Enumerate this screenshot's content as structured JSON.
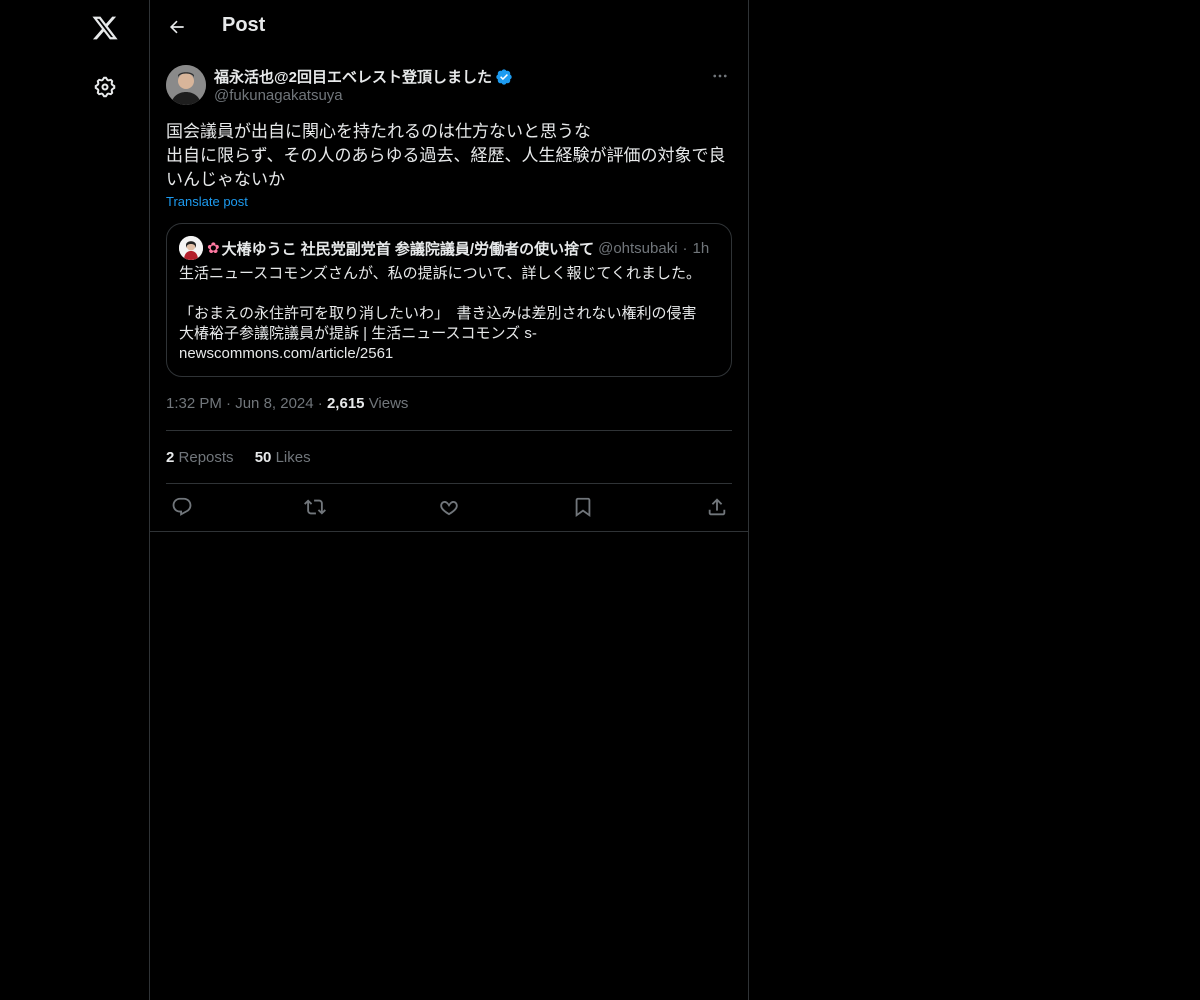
{
  "header": {
    "title": "Post"
  },
  "post": {
    "author_name": "福永活也@2回目エベレスト登頂しました",
    "author_handle": "@fukunagakatsuya",
    "text": "国会議員が出自に関心を持たれるのは仕方ないと思うな\n出自に限らず、その人のあらゆる過去、経歴、人生経験が評価の対象で良いんじゃないか",
    "translate_label": "Translate post",
    "time": "1:32 PM",
    "date": "Jun 8, 2024",
    "views_count": "2,615",
    "views_label": "Views",
    "reposts_count": "2",
    "reposts_label": "Reposts",
    "likes_count": "50",
    "likes_label": "Likes"
  },
  "quote": {
    "name": "大椿ゆうこ 社民党副党首 参議院議員/労働者の使い捨て",
    "handle": "@ohtsubaki",
    "time": "1h",
    "text": "生活ニュースコモンズさんが、私の提訴について、詳しく報じてくれました。\n\n「おまえの永住許可を取り消したいわ」　書き込みは差別されない権利の侵害　大椿裕子参議院議員が提訴 | 生活ニュースコモンズ s-newscommons.com/article/2561"
  },
  "icons": {
    "logo": "x-logo-icon",
    "settings": "gear-icon",
    "back": "arrow-left-icon",
    "verified": "verified-badge-icon",
    "more": "more-horizontal-icon",
    "reply": "reply-icon",
    "repost": "repost-icon",
    "like": "heart-icon",
    "bookmark": "bookmark-icon",
    "share": "share-icon"
  },
  "colors": {
    "background": "#000000",
    "text": "#e7e9ea",
    "muted": "#71767b",
    "accent": "#1d9bf0",
    "border": "#2f3336"
  }
}
